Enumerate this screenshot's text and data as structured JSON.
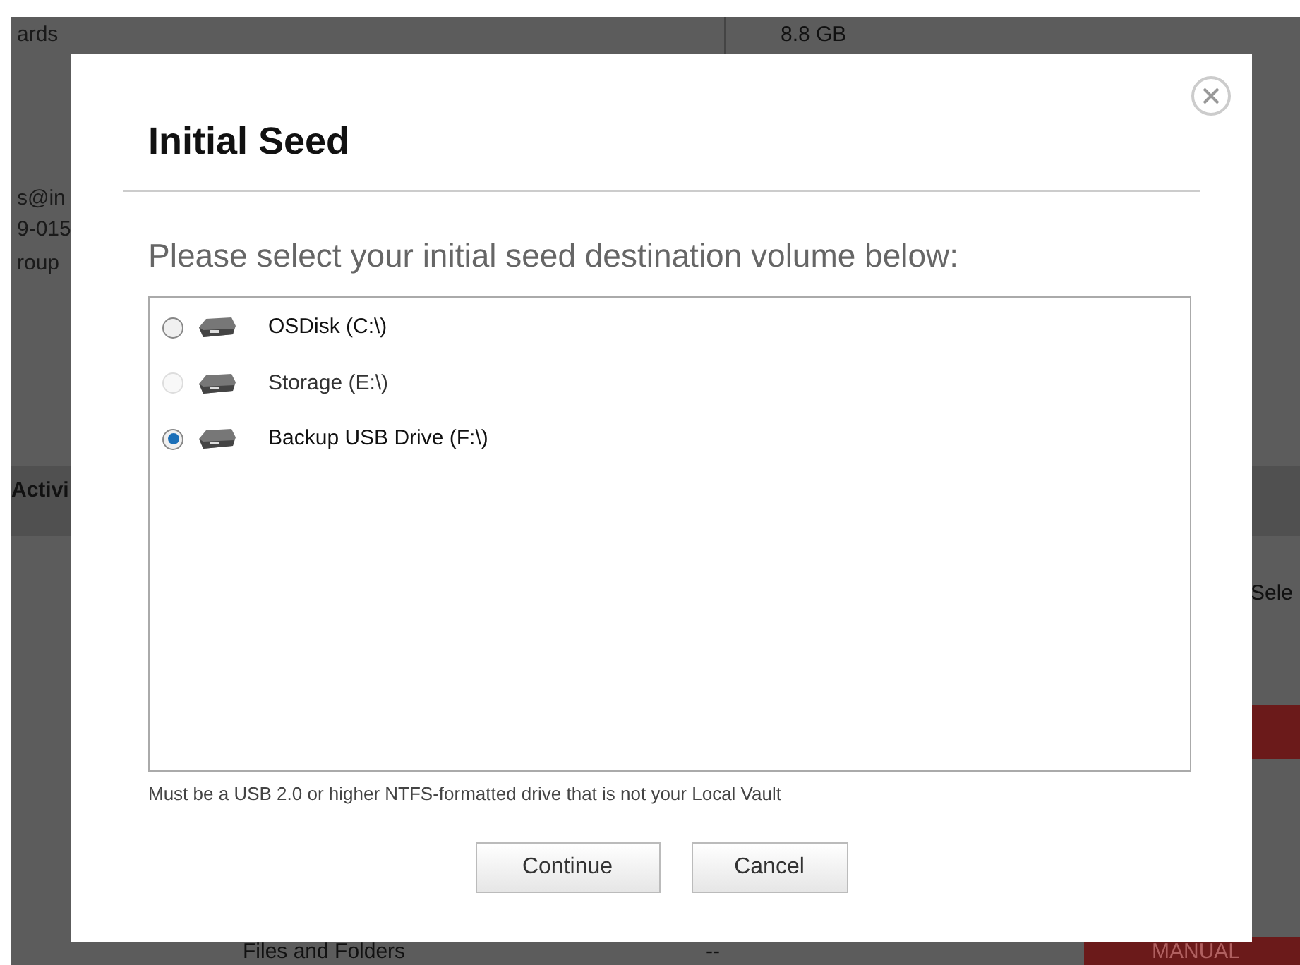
{
  "background": {
    "texts": [
      {
        "kind": "left",
        "text": "ards"
      },
      {
        "kind": "left",
        "text": "s@in"
      },
      {
        "kind": "left",
        "text": "9-015"
      },
      {
        "kind": "left",
        "text": "roup"
      },
      {
        "kind": "heading",
        "text": "Activi"
      },
      {
        "kind": "right",
        "text": "8.8 GB"
      },
      {
        "kind": "far",
        "text": "Sele"
      },
      {
        "kind": "bottom",
        "text": "Files and Folders"
      },
      {
        "kind": "bottom2",
        "text": "--"
      },
      {
        "kind": "badge",
        "text": "MANUAL"
      }
    ]
  },
  "dialog": {
    "title": "Initial Seed",
    "prompt": "Please select your initial seed destination volume below:",
    "volumes": [
      {
        "label": "OSDisk (C:\\)",
        "selected": false,
        "disabled": false
      },
      {
        "label": "Storage (E:\\)",
        "selected": false,
        "disabled": true
      },
      {
        "label": "Backup USB Drive (F:\\)",
        "selected": true,
        "disabled": false
      }
    ],
    "note": "Must be a USB 2.0 or higher NTFS-formatted drive that is not your Local Vault",
    "buttons": [
      "Continue",
      "Cancel"
    ]
  }
}
